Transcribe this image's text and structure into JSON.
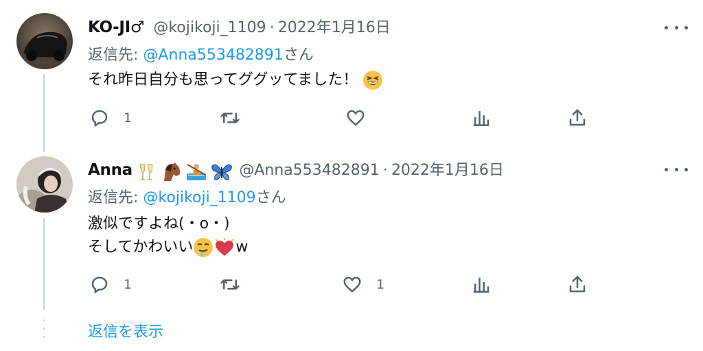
{
  "tweets": [
    {
      "display_name": "KO-JI♂",
      "handle": "@kojikoji_1109",
      "separator": "·",
      "date": "2022年1月16日",
      "reply_to_prefix": "返信先: ",
      "reply_to_handle": "@Anna553482891",
      "reply_to_suffix": "さん",
      "body_lines": [
        "それ昨日自分も思ってググッてました！"
      ],
      "replies": "1",
      "retweets": "",
      "likes": ""
    },
    {
      "display_name": "Anna",
      "handle": "@Anna553482891",
      "separator": "·",
      "date": "2022年1月16日",
      "reply_to_prefix": "返信先: ",
      "reply_to_handle": "@kojikoji_1109",
      "reply_to_suffix": "さん",
      "body_lines": [
        "激似ですよね(・o・)",
        "そしてかわいい",
        "w"
      ],
      "replies": "1",
      "retweets": "",
      "likes": "1"
    }
  ],
  "show_replies_label": "返信を表示",
  "colors": {
    "accent": "#1d9bf0",
    "muted": "#536471",
    "text": "#0f1419",
    "thread_line": "#cfd9de"
  },
  "icons": [
    "reply-icon",
    "retweet-icon",
    "like-icon",
    "analytics-icon",
    "share-icon",
    "more-icon"
  ]
}
